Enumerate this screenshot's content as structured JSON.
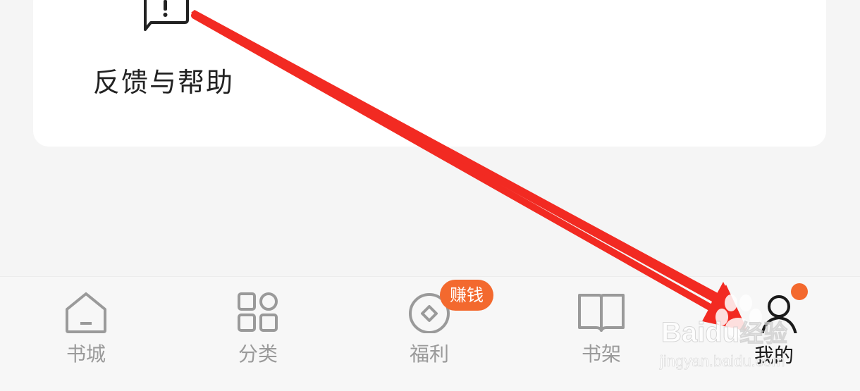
{
  "feedback": {
    "label": "反馈与帮助",
    "icon": "feedback-alert-icon"
  },
  "tabs": [
    {
      "label": "书城",
      "icon": "home-icon",
      "active": false
    },
    {
      "label": "分类",
      "icon": "category-grid-icon",
      "active": false
    },
    {
      "label": "福利",
      "icon": "coin-icon",
      "active": false,
      "badge": "赚钱"
    },
    {
      "label": "书架",
      "icon": "open-book-icon",
      "active": false
    },
    {
      "label": "我的",
      "icon": "person-icon",
      "active": true,
      "notification_dot": true
    }
  ],
  "watermark": {
    "brand": "Baidu",
    "brand_suffix": "经验",
    "url": "jingyan.baidu.com"
  },
  "colors": {
    "accent": "#f3692e",
    "annotation_arrow": "#f22a22",
    "inactive": "#9a9a9a",
    "active": "#1a1a1a"
  }
}
